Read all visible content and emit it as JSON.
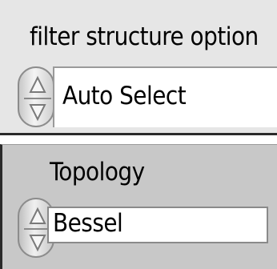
{
  "filter_structure": {
    "label": "filter structure option",
    "value": "Auto Select",
    "increment_icon": "triangle-up-icon",
    "decrement_icon": "triangle-down-icon"
  },
  "topology": {
    "label": "Topology",
    "value": "Bessel",
    "increment_icon": "triangle-up-icon",
    "decrement_icon": "triangle-down-icon"
  },
  "colors": {
    "top_panel_background": "#e6e6e6",
    "bottom_panel_background": "#c8c8c8",
    "field_background": "#ffffff",
    "text": "#000000"
  }
}
